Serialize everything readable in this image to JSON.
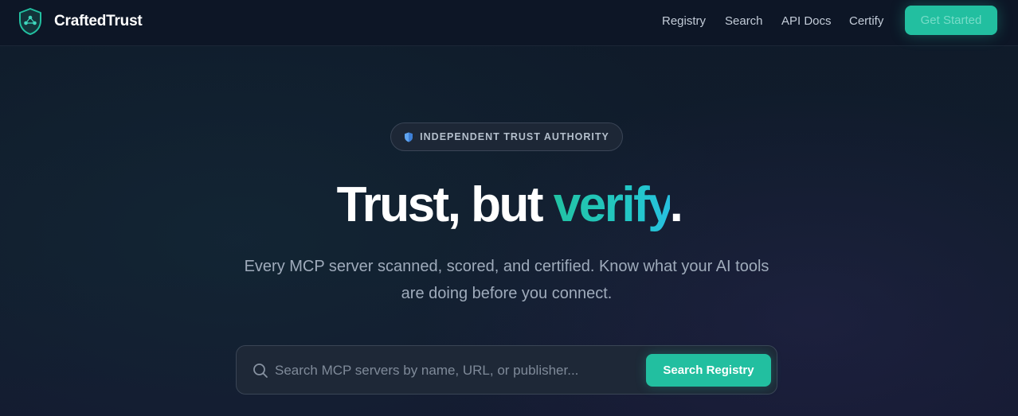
{
  "brand": {
    "name": "CraftedTrust",
    "logo_icon": "shield-network-icon"
  },
  "nav": {
    "links": [
      {
        "label": "Registry"
      },
      {
        "label": "Search"
      },
      {
        "label": "API Docs"
      },
      {
        "label": "Certify"
      }
    ],
    "cta_label": "Get Started"
  },
  "hero": {
    "badge": {
      "icon": "shield-icon",
      "text": "INDEPENDENT TRUST AUTHORITY"
    },
    "headline": {
      "prefix": "Trust, but ",
      "accent": "verify",
      "suffix": "."
    },
    "subtitle": "Every MCP server scanned, scored, and certified. Know what your AI tools are doing before you connect."
  },
  "search": {
    "icon": "search-icon",
    "placeholder": "Search MCP servers by name, URL, or publisher...",
    "value": "",
    "button_label": "Search Registry"
  },
  "colors": {
    "accent": "#22bfa0",
    "accent_cyan": "#27c0e0",
    "background": "#101a29",
    "nav_background": "#0d1626"
  }
}
